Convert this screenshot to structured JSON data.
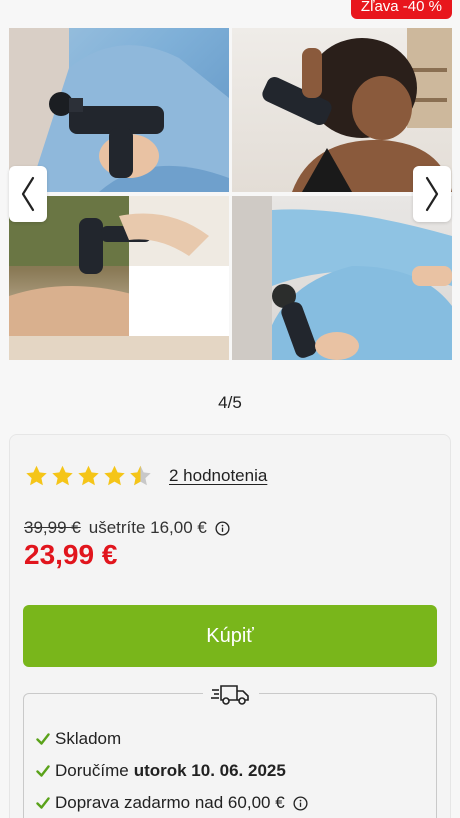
{
  "badge": {
    "label": "Zľava -40 %"
  },
  "gallery": {
    "images": [
      {
        "name": "massage-gun-held-by-woman-in-blue"
      },
      {
        "name": "massage-gun-on-shoulder"
      },
      {
        "name": "massage-gun-on-back"
      },
      {
        "name": "massage-gun-on-leg"
      }
    ],
    "counter": "4/5",
    "prev_icon": "chevron-left-icon",
    "next_icon": "chevron-right-icon"
  },
  "rating": {
    "stars": 4.5,
    "max_stars": 5,
    "reviews_label": "2 hodnotenia",
    "star_color": "#f5c518"
  },
  "price": {
    "old": "39,99 €",
    "saving": "ušetríte 16,00 €",
    "current": "23,99 €",
    "current_color": "#e1151d"
  },
  "buy_button": {
    "label": "Kúpiť",
    "color": "#79b61b"
  },
  "delivery": {
    "icon": "truck-icon",
    "stock": "Skladom",
    "delivery_prefix": "Doručíme",
    "delivery_date": "utorok 10. 06. 2025",
    "free_shipping": "Doprava zadarmo nad 60,00 €"
  }
}
